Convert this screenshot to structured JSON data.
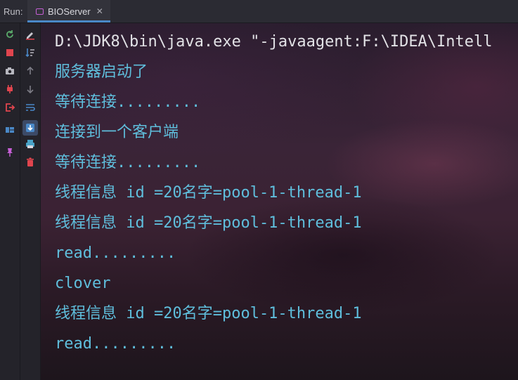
{
  "run_label": "Run:",
  "tab": {
    "title": "BIOServer",
    "close": "✕"
  },
  "console_lines": [
    {
      "text": "D:\\JDK8\\bin\\java.exe \"-javaagent:F:\\IDEA\\Intell",
      "kind": "cmd"
    },
    {
      "text": "服务器启动了",
      "kind": "out"
    },
    {
      "text": "等待连接.........",
      "kind": "out"
    },
    {
      "text": "连接到一个客户端",
      "kind": "out"
    },
    {
      "text": "等待连接.........",
      "kind": "out"
    },
    {
      "text": "线程信息 id =20名字=pool-1-thread-1",
      "kind": "out"
    },
    {
      "text": "线程信息 id =20名字=pool-1-thread-1",
      "kind": "out"
    },
    {
      "text": "read.........",
      "kind": "out"
    },
    {
      "text": "clover",
      "kind": "out"
    },
    {
      "text": "线程信息 id =20名字=pool-1-thread-1",
      "kind": "out"
    },
    {
      "text": "read.........",
      "kind": "out"
    }
  ],
  "colors": {
    "output_text": "#5fbedc",
    "command_text": "#e2e2e6",
    "accent": "#4a88c7"
  }
}
